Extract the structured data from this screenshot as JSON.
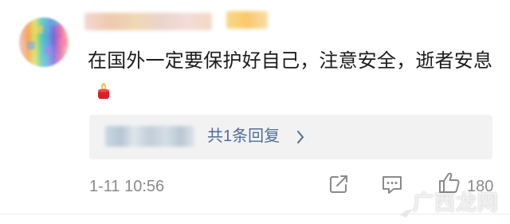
{
  "comment": {
    "text": "在国外一定要保护好自己，注意安全，逝者安息",
    "emoji": "candle-icon"
  },
  "replies": {
    "summary": "共1条回复"
  },
  "meta": {
    "timestamp": "1-11 10:56",
    "like_count": "180"
  },
  "watermark": {
    "text": "广西龙网"
  },
  "colors": {
    "link_blue": "#506e96",
    "muted_gray": "#8a8a8a",
    "reply_bg": "#f2f2f2"
  }
}
